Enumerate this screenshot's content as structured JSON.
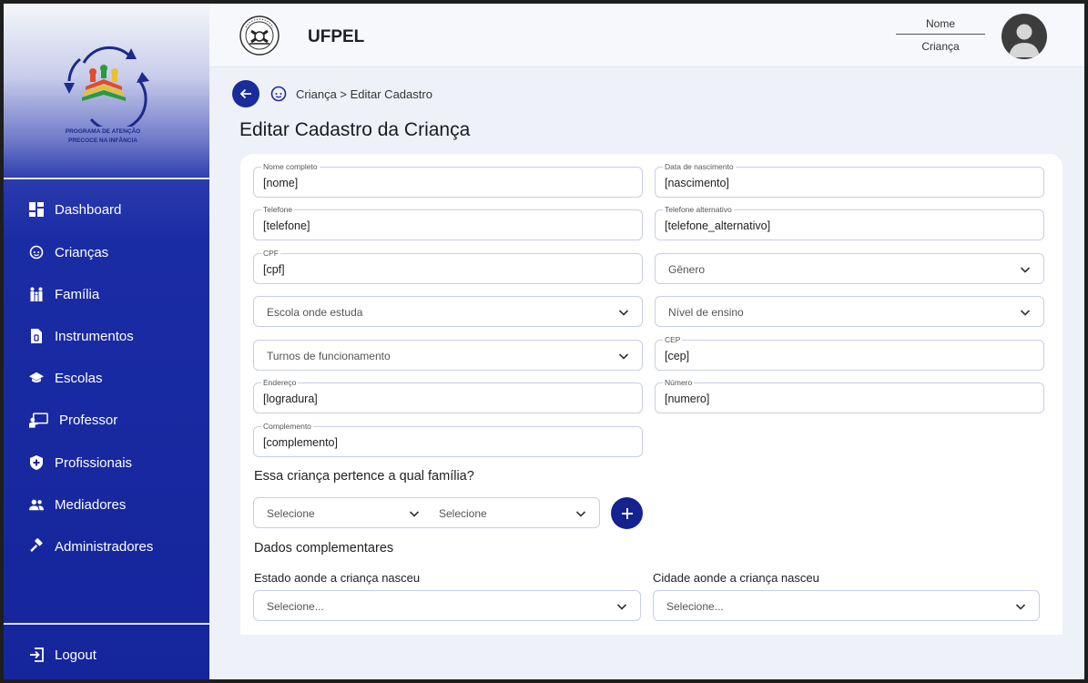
{
  "sidebar": {
    "logo_text_line1": "PROGRAMA DE ATENÇÃO",
    "logo_text_line2": "PRECOCE NA INFÂNCIA",
    "items": [
      {
        "label": "Dashboard",
        "icon": "dashboard-icon"
      },
      {
        "label": "Crianças",
        "icon": "child-face-icon"
      },
      {
        "label": "Família",
        "icon": "family-icon"
      },
      {
        "label": "Instrumentos",
        "icon": "document-icon"
      },
      {
        "label": "Escolas",
        "icon": "school-icon"
      },
      {
        "label": "Professor",
        "icon": "teacher-icon"
      },
      {
        "label": "Profissionais",
        "icon": "shield-plus-icon"
      },
      {
        "label": "Mediadores",
        "icon": "group-icon"
      },
      {
        "label": "Administradores",
        "icon": "gavel-icon"
      }
    ],
    "logout_label": "Logout"
  },
  "header": {
    "org_name": "UFPEL",
    "user_name": "Nome",
    "user_role": "Criança"
  },
  "breadcrumb": "Criança > Editar Cadastro",
  "page_title": "Editar Cadastro da Criança",
  "form": {
    "nome": {
      "label": "Nome completo",
      "value": "[nome]"
    },
    "nascimento": {
      "label": "Data de nascimento",
      "value": "[nascimento]"
    },
    "telefone": {
      "label": "Telefone",
      "value": "[telefone]"
    },
    "telefone_alt": {
      "label": "Telefone alternativo",
      "value": "[telefone_alternativo]"
    },
    "cpf": {
      "label": "CPF",
      "value": "[cpf]"
    },
    "genero": {
      "placeholder": "Gênero"
    },
    "escola": {
      "placeholder": "Escola onde estuda"
    },
    "nivel": {
      "placeholder": "Nível de ensino"
    },
    "turnos": {
      "placeholder": "Turnos de funcionamento"
    },
    "cep": {
      "label": "CEP",
      "value": "[cep]"
    },
    "endereco": {
      "label": "Endereço",
      "value": "[logradura]"
    },
    "numero": {
      "label": "Número",
      "value": "[numero]"
    },
    "complemento": {
      "label": "Complemento",
      "value": "[complemento]"
    },
    "familia_title": "Essa criança pertence a qual família?",
    "familia_select1": "Selecione",
    "familia_select2": "Selecione",
    "dados_title": "Dados complementares",
    "estado_label": "Estado aonde a criança nasceu",
    "estado_value": "Selecione...",
    "cidade_label": "Cidade aonde a criança nasceu",
    "cidade_value": "Selecione..."
  },
  "colors": {
    "primary": "#1a2b9c",
    "sidebar": "#15259c",
    "border": "#c9cde8"
  }
}
